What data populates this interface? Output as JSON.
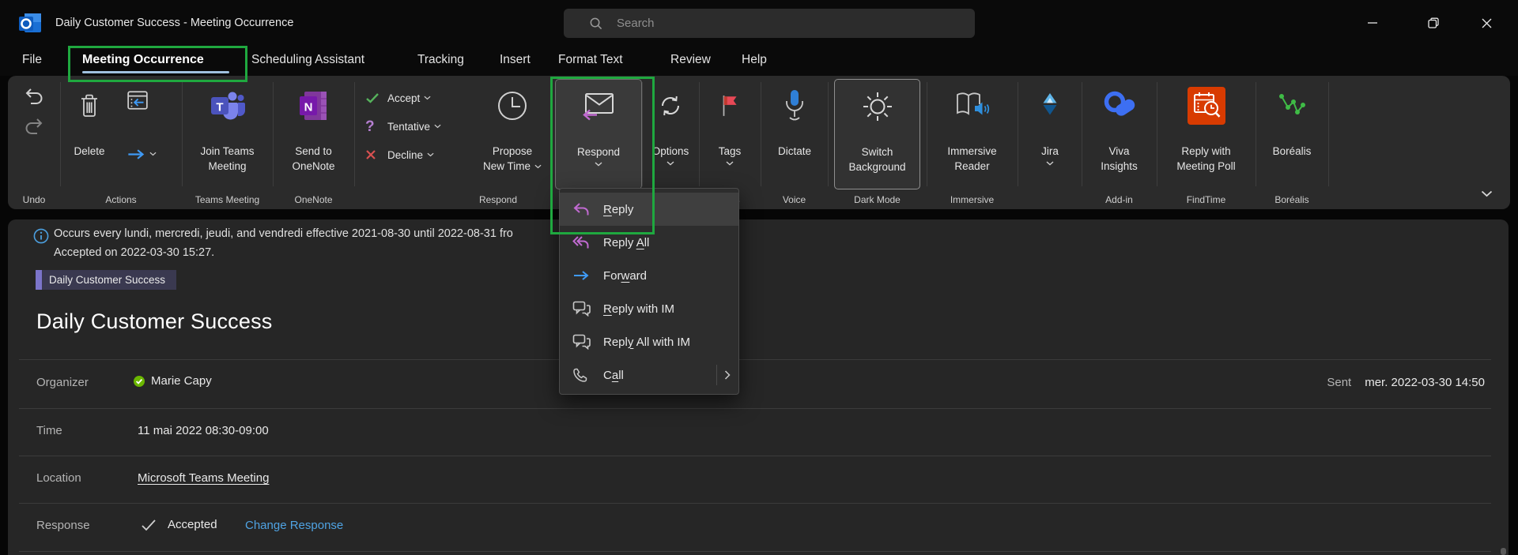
{
  "window": {
    "title": "Daily Customer Success  -  Meeting Occurrence",
    "search_placeholder": "Search"
  },
  "tabs": [
    {
      "label": "File"
    },
    {
      "label": "Meeting Occurrence",
      "active": true
    },
    {
      "label": "Scheduling Assistant"
    },
    {
      "label": "Tracking"
    },
    {
      "label": "Insert"
    },
    {
      "label": "Format Text"
    },
    {
      "label": "Review"
    },
    {
      "label": "Help"
    }
  ],
  "ribbon": {
    "groups": {
      "undo": {
        "label": "Undo"
      },
      "actions": {
        "label": "Actions",
        "delete": "Delete"
      },
      "teams": {
        "label": "Teams Meeting",
        "join_line1": "Join Teams",
        "join_line2": "Meeting"
      },
      "onenote": {
        "label": "OneNote",
        "send_line1": "Send to",
        "send_line2": "OneNote"
      },
      "respond": {
        "label": "Respond",
        "accept": "Accept",
        "tentative": "Tentative",
        "decline": "Decline",
        "propose_line1": "Propose",
        "propose_line2": "New Time",
        "respond": "Respond"
      },
      "options": {
        "label": "Options",
        "button": "Options"
      },
      "tags": {
        "label": "Tags",
        "button": "Tags"
      },
      "voice": {
        "label": "Voice",
        "dictate": "Dictate"
      },
      "dark_mode": {
        "label": "Dark Mode",
        "line1": "Switch",
        "line2": "Background"
      },
      "immersive": {
        "label": "Immersive",
        "line1": "Immersive",
        "line2": "Reader"
      },
      "jira": {
        "button": "Jira"
      },
      "addin": {
        "label": "Add-in",
        "line1": "Viva",
        "line2": "Insights"
      },
      "findtime": {
        "label": "FindTime",
        "line1": "Reply with",
        "line2": "Meeting Poll"
      },
      "borealis": {
        "label": "Boréalis",
        "button": "Boréalis"
      }
    }
  },
  "respond_menu": {
    "items": [
      {
        "pre": "",
        "key": "R",
        "post": "eply"
      },
      {
        "pre": "Reply ",
        "key": "A",
        "post": "ll"
      },
      {
        "pre": "For",
        "key": "w",
        "post": "ard"
      },
      {
        "pre": "",
        "key": "R",
        "post": "eply with IM"
      },
      {
        "pre": "Repl",
        "key": "y",
        "post": " All with IM"
      },
      {
        "pre": "C",
        "key": "a",
        "post": "ll"
      }
    ]
  },
  "message": {
    "info_line1": "Occurs every lundi, mercredi, jeudi, and vendredi effective 2021-08-30 until 2022-08-31 fro",
    "info_line2": "Accepted on 2022-03-30 15:27.",
    "category": "Daily Customer Success",
    "title": "Daily Customer Success",
    "organizer_label": "Organizer",
    "organizer": "Marie Capy",
    "sent_label": "Sent",
    "sent": "mer. 2022-03-30 14:50",
    "time_label": "Time",
    "time": "11 mai 2022 08:30-09:00",
    "location_label": "Location",
    "location": "Microsoft Teams Meeting",
    "response_label": "Response",
    "response_status": "Accepted",
    "response_action": "Change Response"
  },
  "colors": {
    "annotation_green": "#1fa83f",
    "tab_underline": "#9fc0de",
    "link_blue": "#4fa3e3",
    "category_purple": "#7b74c9",
    "accept_green": "#56b35c",
    "tentative_purple": "#b57fd1",
    "decline_red": "#d85050",
    "reply_purple": "#c06ad0",
    "forward_blue": "#3f9af5",
    "findtime_orange": "#d83b01",
    "borealis_green": "#3fbb46",
    "presence_green": "#6bb700"
  }
}
